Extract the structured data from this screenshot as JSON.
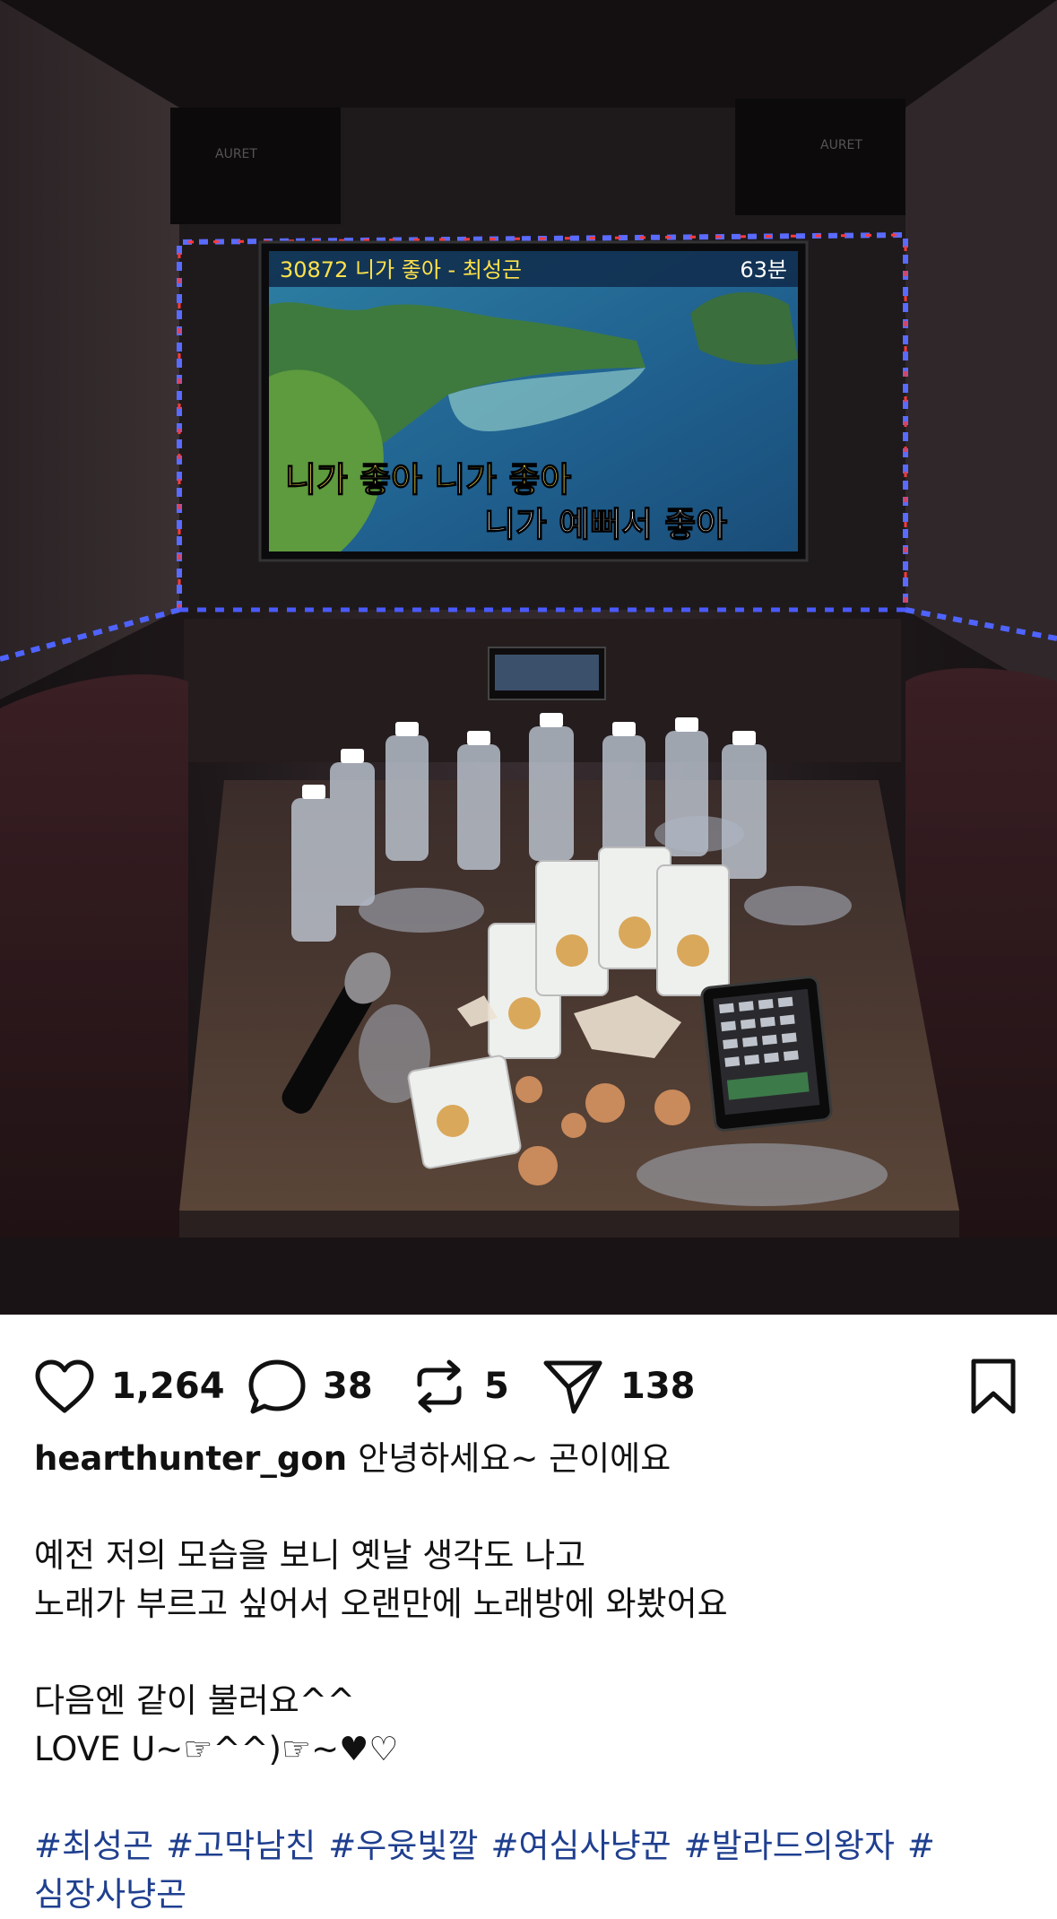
{
  "photo": {
    "screen_banner": "30872 니가 좋아 - 최성곤",
    "screen_minutes": "63분",
    "lyric_line_1": "니가 좋아 니가 좋아",
    "lyric_line_2": "니가 예뻐서 좋아",
    "speaker_brand": "AURET"
  },
  "actions": {
    "likes": "1,264",
    "comments": "38",
    "reposts": "5",
    "shares": "138"
  },
  "post": {
    "username": "hearthunter_gon",
    "lines": [
      "안녕하세요~ 곤이에요",
      "예전 저의 모습을 보니 옛날 생각도 나고",
      "노래가 부르고 싶어서 오랜만에 노래방에 와봤어요",
      "다음엔 같이 불러요^^",
      "LOVE U~☞^^)☞~♥♡"
    ],
    "hashtags": [
      "#최성곤",
      "#고막남친",
      "#우윳빛깔",
      "#여심사냥꾼",
      "#발라드의왕자",
      "#심장사냥곤"
    ]
  }
}
